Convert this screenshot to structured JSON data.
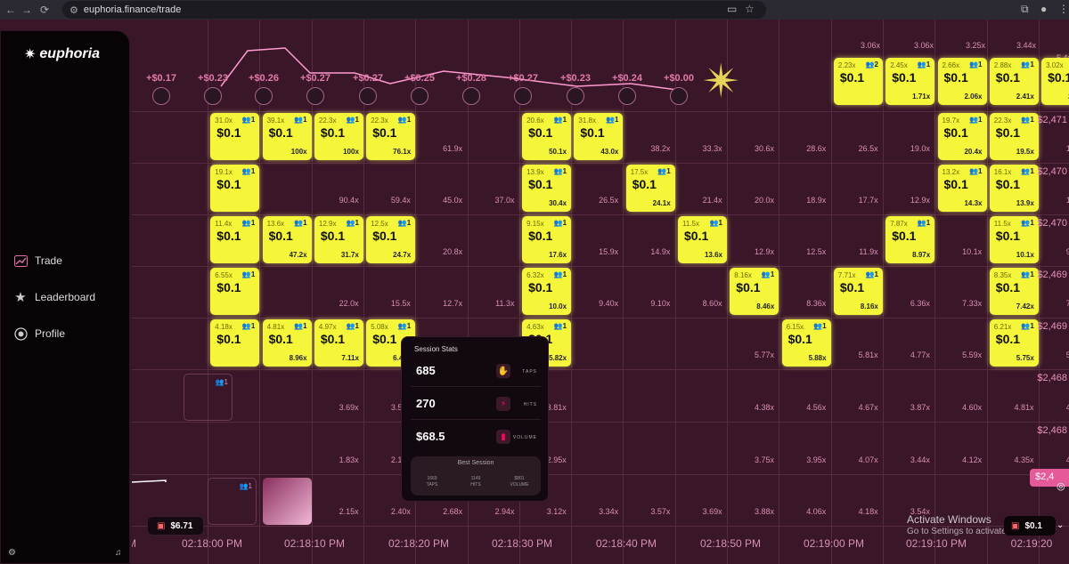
{
  "browser": {
    "url": "euphoria.finance/trade"
  },
  "brand": {
    "name": "euphoria"
  },
  "nav": [
    {
      "label": "Trade",
      "icon": "chart-icon"
    },
    {
      "label": "Leaderboard",
      "icon": "star-icon"
    },
    {
      "label": "Profile",
      "icon": "user-circle-icon"
    }
  ],
  "top_labels": [
    "+$0.17",
    "+$0.23",
    "+$0.26",
    "+$0.27",
    "+$0.27",
    "+$0.25",
    "+$0.28",
    "+$0.27",
    "+$0.23",
    "+$0.24",
    "+$0.00"
  ],
  "top_row_mults": [
    "3.06x",
    "3.06x",
    "3.25x",
    "3.44x",
    "5.4x"
  ],
  "cells": [
    {
      "m": "2.23x",
      "c": "2",
      "v": "$0.1",
      "p": ""
    },
    {
      "m": "2.45x",
      "c": "1",
      "v": "$0.1",
      "p": "1.71x"
    },
    {
      "m": "2.66x",
      "c": "1",
      "v": "$0.1",
      "p": "2.06x"
    },
    {
      "m": "2.88x",
      "c": "1",
      "v": "$0.1",
      "p": "2.41x"
    },
    {
      "m": "3.02x",
      "c": "1",
      "v": "$0.1",
      "p": "2.70x"
    },
    {
      "m": "31.0x",
      "c": "1",
      "v": "$0.1",
      "p": ""
    },
    {
      "m": "39.1x",
      "c": "1",
      "v": "$0.1",
      "p": "100x"
    },
    {
      "m": "22.3x",
      "c": "1",
      "v": "$0.1",
      "p": "100x"
    },
    {
      "m": "22.3x",
      "c": "1",
      "v": "$0.1",
      "p": "76.1x"
    },
    {
      "m": "20.6x",
      "c": "1",
      "v": "$0.1",
      "p": "50.1x"
    },
    {
      "m": "31.8x",
      "c": "1",
      "v": "$0.1",
      "p": "43.0x"
    },
    {
      "m": "19.7x",
      "c": "1",
      "v": "$0.1",
      "p": "20.4x"
    },
    {
      "m": "22.3x",
      "c": "1",
      "v": "$0.1",
      "p": "19.5x"
    },
    {
      "m": "19.1x",
      "c": "1",
      "v": "$0.1",
      "p": ""
    },
    {
      "m": "13.9x",
      "c": "1",
      "v": "$0.1",
      "p": "30.4x"
    },
    {
      "m": "17.5x",
      "c": "1",
      "v": "$0.1",
      "p": "24.1x"
    },
    {
      "m": "13.2x",
      "c": "1",
      "v": "$0.1",
      "p": "14.3x"
    },
    {
      "m": "16.1x",
      "c": "1",
      "v": "$0.1",
      "p": "13.9x"
    },
    {
      "m": "11.4x",
      "c": "1",
      "v": "$0.1",
      "p": ""
    },
    {
      "m": "13.6x",
      "c": "1",
      "v": "$0.1",
      "p": "47.2x"
    },
    {
      "m": "12.9x",
      "c": "1",
      "v": "$0.1",
      "p": "31.7x"
    },
    {
      "m": "12.5x",
      "c": "1",
      "v": "$0.1",
      "p": "24.7x"
    },
    {
      "m": "9.15x",
      "c": "1",
      "v": "$0.1",
      "p": "17.6x"
    },
    {
      "m": "11.5x",
      "c": "1",
      "v": "$0.1",
      "p": "13.6x"
    },
    {
      "m": "7.87x",
      "c": "1",
      "v": "$0.1",
      "p": "8.97x"
    },
    {
      "m": "11.5x",
      "c": "1",
      "v": "$0.1",
      "p": "10.1x"
    },
    {
      "m": "6.55x",
      "c": "1",
      "v": "$0.1",
      "p": ""
    },
    {
      "m": "6.32x",
      "c": "1",
      "v": "$0.1",
      "p": "10.0x"
    },
    {
      "m": "8.16x",
      "c": "1",
      "v": "$0.1",
      "p": "8.46x"
    },
    {
      "m": "7.71x",
      "c": "1",
      "v": "$0.1",
      "p": "8.16x"
    },
    {
      "m": "8.35x",
      "c": "1",
      "v": "$0.1",
      "p": "7.42x"
    },
    {
      "m": "4.18x",
      "c": "1",
      "v": "$0.1",
      "p": ""
    },
    {
      "m": "4.81x",
      "c": "1",
      "v": "$0.1",
      "p": "8.96x"
    },
    {
      "m": "4.97x",
      "c": "1",
      "v": "$0.1",
      "p": "7.11x"
    },
    {
      "m": "5.08x",
      "c": "1",
      "v": "$0.1",
      "p": "6.44x"
    },
    {
      "m": "4.63x",
      "c": "1",
      "v": "$0.1",
      "p": "5.82x"
    },
    {
      "m": "6.15x",
      "c": "1",
      "v": "$0.1",
      "p": "5.88x"
    },
    {
      "m": "6.21x",
      "c": "1",
      "v": "$0.1",
      "p": "5.75x"
    }
  ],
  "mults": [
    "61.9x",
    "38.2x",
    "33.3x",
    "30.6x",
    "28.6x",
    "26.5x",
    "19.0x",
    "18.8x",
    "90.4x",
    "59.4x",
    "45.0x",
    "37.0x",
    "26.5x",
    "21.4x",
    "20.0x",
    "18.9x",
    "17.7x",
    "12.9x",
    "13.6x",
    "20.8x",
    "15.9x",
    "14.9x",
    "12.9x",
    "12.5x",
    "11.9x",
    "10.1x",
    "9.96x",
    "22.0x",
    "15.5x",
    "12.7x",
    "11.3x",
    "9.40x",
    "9.10x",
    "8.60x",
    "8.36x",
    "6.36x",
    "7.33x",
    "7.48x",
    "6.16x",
    "5.77x",
    "5.81x",
    "4.77x",
    "5.59x",
    "5.87x",
    "3.69x",
    "3.51x",
    "3.60x",
    "3.74x",
    "3.81x",
    "4.38x",
    "4.56x",
    "4.67x",
    "3.87x",
    "4.60x",
    "4.81x",
    "4.99x",
    "1.83x",
    "2.14x",
    "2.46x",
    "2.73x",
    "2.95x",
    "3.75x",
    "3.95x",
    "4.07x",
    "3.44x",
    "4.12x",
    "4.35x",
    "4.55x",
    "2.15x",
    "2.40x",
    "2.68x",
    "2.94x",
    "3.12x",
    "3.34x",
    "3.57x",
    "3.69x",
    "3.88x",
    "4.06x",
    "4.18x",
    "3.54x"
  ],
  "right_prices": [
    "$2,471",
    "$2,470",
    "$2,470",
    "$2,469",
    "$2,469",
    "$2,468",
    "$2,468",
    "$2,4"
  ],
  "player_count": "1",
  "timeline": [
    "M",
    "02:18:00 PM",
    "02:18:10 PM",
    "02:18:20 PM",
    "02:18:30 PM",
    "02:18:40 PM",
    "02:18:50 PM",
    "02:19:00 PM",
    "02:19:10 PM",
    "02:19:20"
  ],
  "session": {
    "title": "Session Stats",
    "taps": "685",
    "taps_label": "TAPS",
    "hits": "270",
    "hits_label": "HITS",
    "volume": "$68.5",
    "volume_label": "VOLUME",
    "best": {
      "title": "Best Session",
      "taps": "1669",
      "taps_label": "TAPS",
      "hits": "1149",
      "hits_label": "HITS",
      "volume": "$801",
      "volume_label": "VOLUME"
    }
  },
  "balance": "$6.71",
  "bet": "$0.1",
  "activate": {
    "line1": "Activate Windows",
    "line2": "Go to Settings to activate Windows."
  }
}
